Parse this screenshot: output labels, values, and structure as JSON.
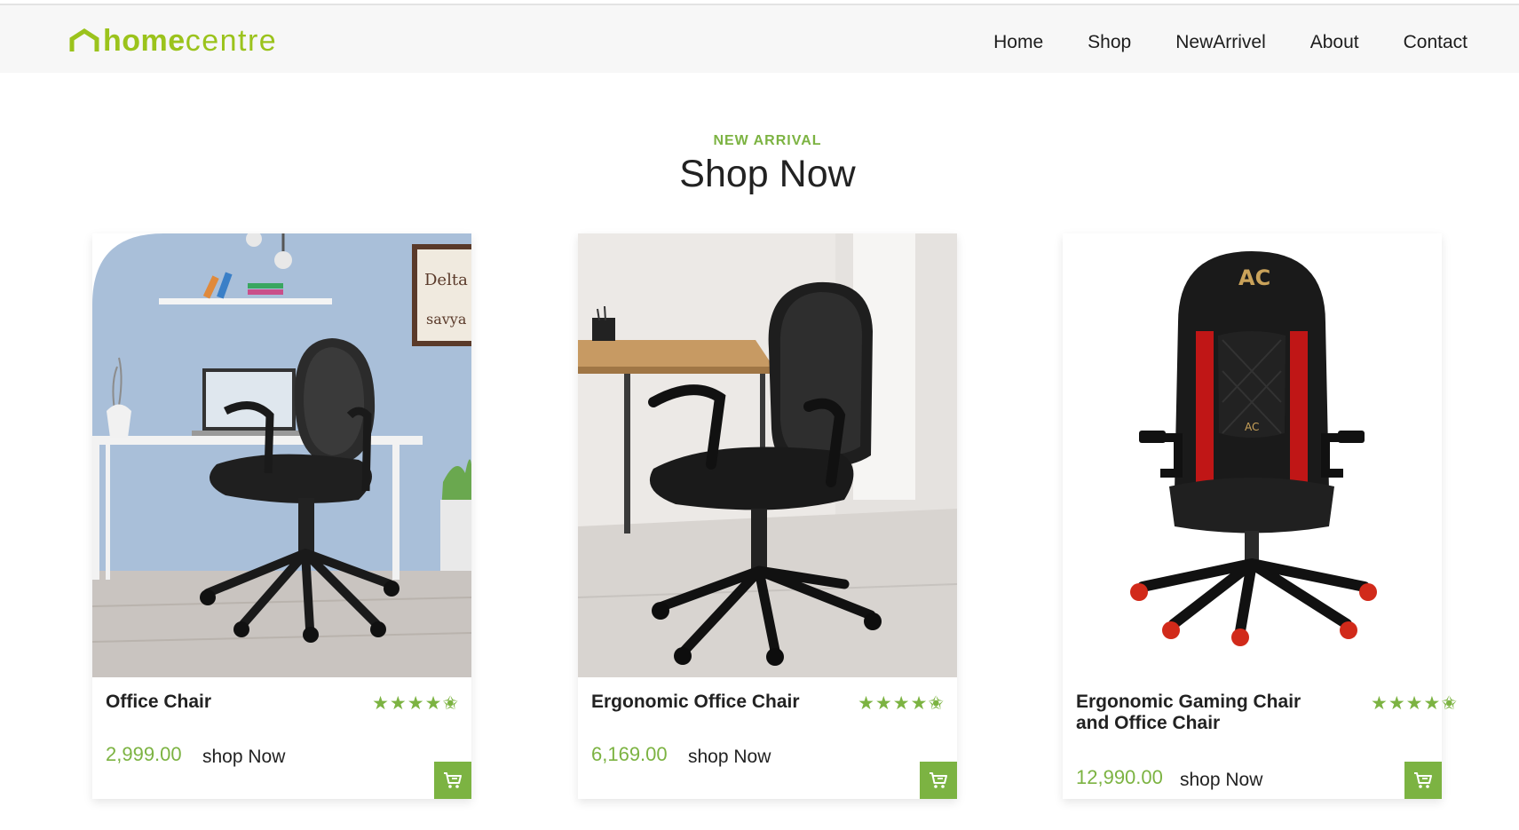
{
  "brand": {
    "home": "home",
    "centre": "centre",
    "color": "#9bc31c"
  },
  "nav": {
    "home": "Home",
    "shop": "Shop",
    "new_arrival": "NewArrivel",
    "about": "About",
    "contact": "Contact"
  },
  "section": {
    "eyebrow": "NEW ARRIVAL",
    "title": "Shop Now"
  },
  "accent_color": "#7cb342",
  "products": [
    {
      "name": "Office Chair",
      "rating": 4.5,
      "price": "2,999.00",
      "cta": "shop Now",
      "icon": "cart-icon"
    },
    {
      "name": "Ergonomic Office Chair",
      "rating": 4.5,
      "price": "6,169.00",
      "cta": "shop Now",
      "icon": "cart-icon"
    },
    {
      "name": "Ergonomic Gaming Chair and Office Chair",
      "rating": 4.5,
      "price": "12,990.00",
      "cta": "shop Now",
      "icon": "cart-icon"
    }
  ]
}
